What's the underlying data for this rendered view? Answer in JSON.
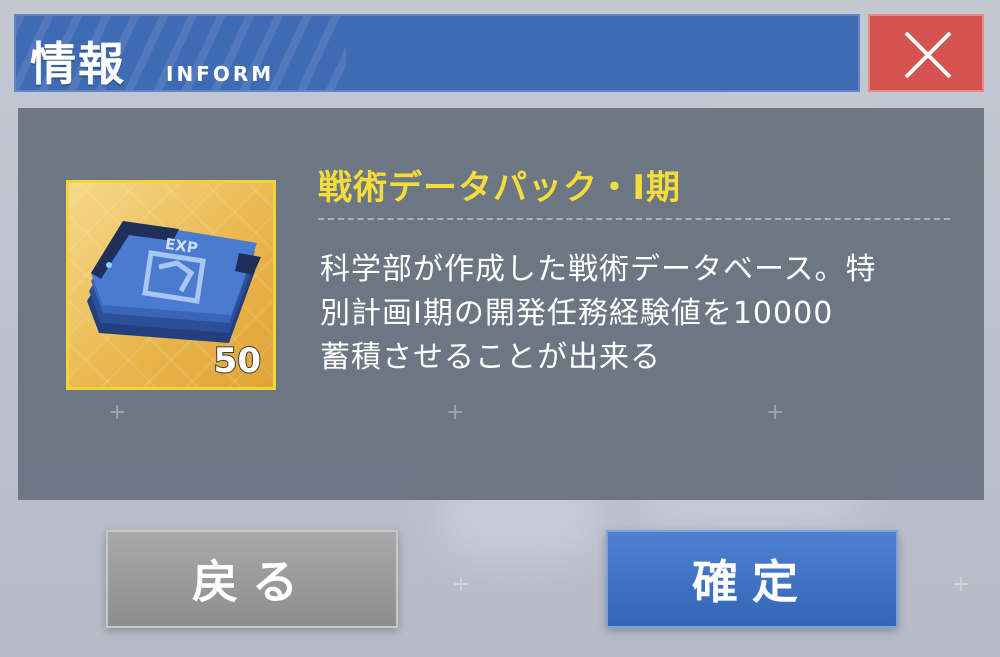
{
  "dialog": {
    "title_jp": "情報",
    "title_en": "INFORM",
    "close_icon": "close-x-icon"
  },
  "item": {
    "name": "戦術データパック・Ⅰ期",
    "description": "科学部が作成した戦術データベース。特\n別計画Ⅰ期の開発任務経験値を10000\n蓄積させることが出来る",
    "count": "50",
    "icon": "exp-data-card-icon",
    "icon_label": "EXP"
  },
  "buttons": {
    "back_label": "戻る",
    "confirm_label": "確定"
  },
  "colors": {
    "header": "#3f6ab4",
    "close": "#d4524f",
    "title_accent": "#f5dc3a",
    "confirm": "#3f73c4",
    "back": "#9a9a9a"
  }
}
